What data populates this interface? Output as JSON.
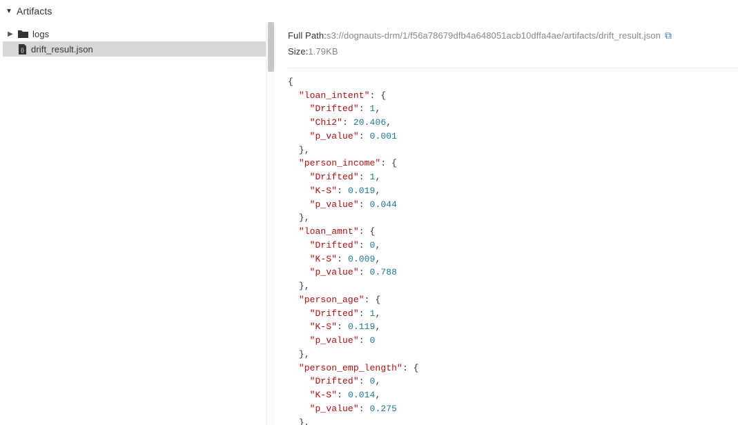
{
  "header": {
    "title": "Artifacts"
  },
  "sidebar": {
    "items": [
      {
        "label": "logs",
        "type": "folder",
        "expandable": true
      },
      {
        "label": "drift_result.json",
        "type": "file",
        "selected": true
      }
    ]
  },
  "details": {
    "full_path_label": "Full Path:",
    "full_path_value": "s3://dognauts-drm/1/f56a78679dfb4a648051acb10dffa4ae/artifacts/drift_result.json",
    "size_label": "Size:",
    "size_value": " 1.79KB"
  },
  "json": {
    "loan_intent": {
      "Drifted": 1,
      "Chi2": 20.406,
      "p_value": 0.001
    },
    "person_income": {
      "Drifted": 1,
      "K-S": 0.019,
      "p_value": 0.044
    },
    "loan_amnt": {
      "Drifted": 0,
      "K-S": 0.009,
      "p_value": 0.788
    },
    "person_age": {
      "Drifted": 1,
      "K-S": 0.119,
      "p_value": 0
    },
    "person_emp_length": {
      "Drifted": 0,
      "K-S": 0.014,
      "p_value": 0.275
    }
  }
}
